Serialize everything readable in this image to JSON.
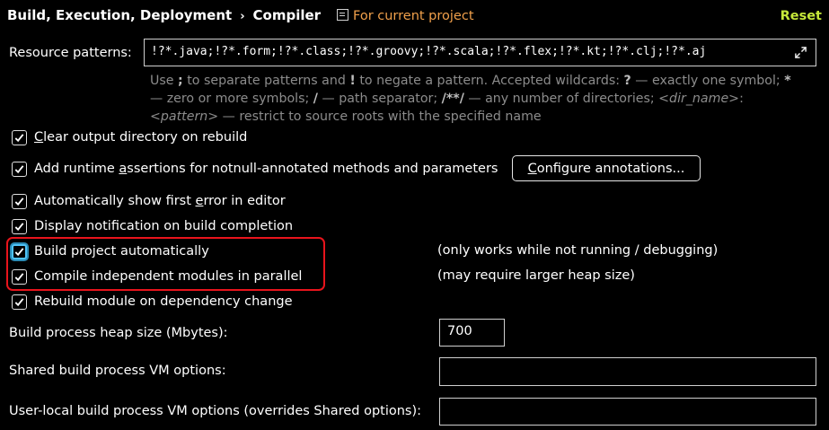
{
  "header": {
    "breadcrumb_parent": "Build, Execution, Deployment",
    "breadcrumb_separator": "›",
    "breadcrumb_current": "Compiler",
    "scope_label": "For current project",
    "reset_label": "Reset"
  },
  "resource_patterns": {
    "label": "Resource patterns:",
    "value": "!?*.java;!?*.form;!?*.class;!?*.groovy;!?*.scala;!?*.flex;!?*.kt;!?*.clj;!?*.aj",
    "help": {
      "p1": "Use ",
      "b1": ";",
      "p2": " to separate patterns and ",
      "b2": "!",
      "p3": " to negate a pattern. Accepted wildcards: ",
      "b3": "?",
      "p4": " — exactly one symbol; ",
      "b4": "*",
      "p5": " — zero or more symbols; ",
      "b5": "/",
      "p6": " — path separator; ",
      "b6": "/**/",
      "p7": " — any number of directories; ",
      "i1": "<dir_name>",
      "p8": ":",
      "i2": "<pattern>",
      "p9": " — restrict to source roots with the specified name"
    }
  },
  "options": {
    "clear_output": {
      "pre": "",
      "mn": "C",
      "post": "lear output directory on rebuild",
      "checked": true
    },
    "runtime_assertions": {
      "pre": "Add runtime ",
      "mn": "a",
      "post": "ssertions for notnull-annotated methods and parameters",
      "checked": true
    },
    "configure_annotations": {
      "mn": "C",
      "post": "onfigure annotations..."
    },
    "show_first_error": {
      "pre": "Automatically show first ",
      "mn": "e",
      "post": "rror in editor",
      "checked": true
    },
    "display_notification": {
      "text": "Display notification on build completion",
      "checked": true
    },
    "build_automatically": {
      "text": "Build project automatically",
      "checked": true,
      "note": "(only works while not running / debugging)"
    },
    "compile_parallel": {
      "text": "Compile independent modules in parallel",
      "checked": true,
      "note": "(may require larger heap size)"
    },
    "rebuild_on_dependency": {
      "text": "Rebuild module on dependency change",
      "checked": true
    }
  },
  "heap": {
    "label": "Build process heap size (Mbytes):",
    "value": "700"
  },
  "shared_vm": {
    "label": "Shared build process VM options:",
    "value": ""
  },
  "user_vm": {
    "label": "User-local build process VM options (overrides Shared options):",
    "value": ""
  },
  "colors": {
    "background": "#000000",
    "scope_accent": "#f0a04b",
    "reset_accent": "#c6e83a",
    "highlight_box": "#e8141c",
    "focus_ring": "#4fc3f7"
  },
  "icons": {
    "scope": "project-scope-icon",
    "expand": "expand-icon",
    "checkbox": "checkmark-icon"
  }
}
